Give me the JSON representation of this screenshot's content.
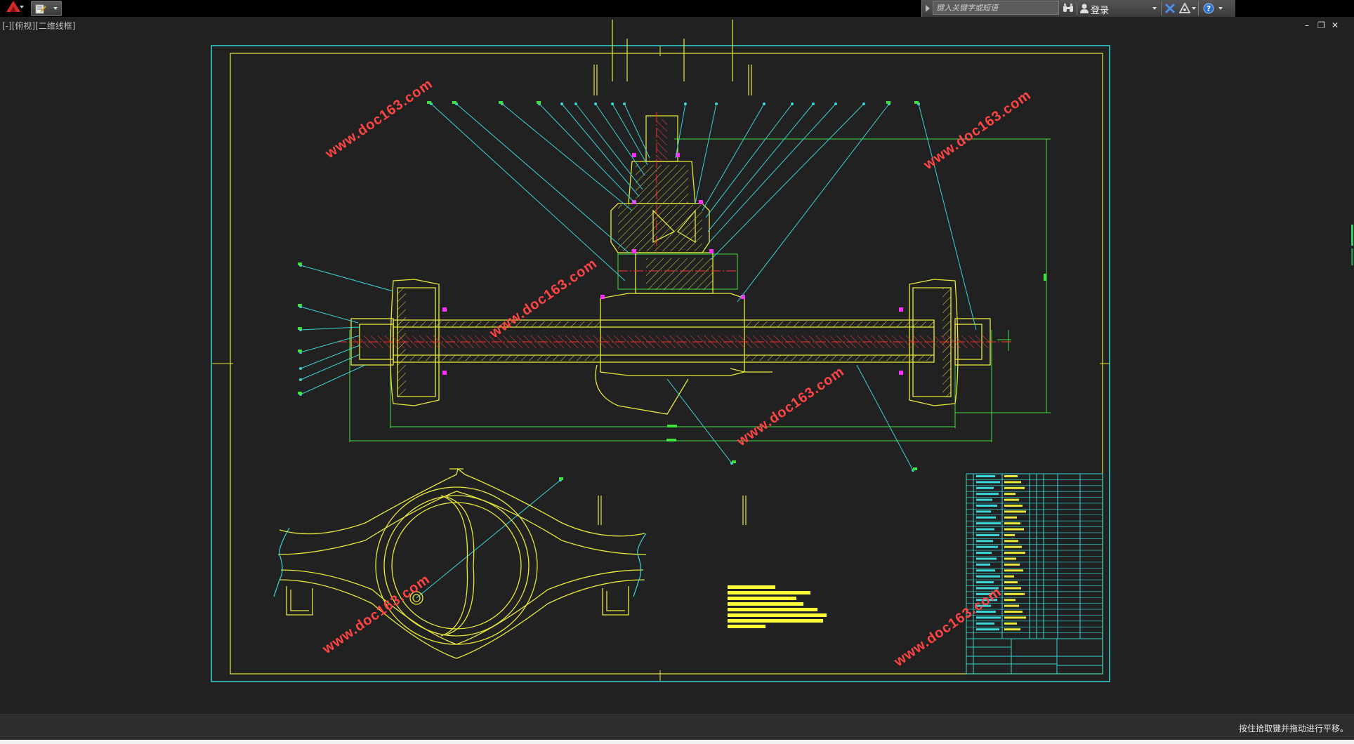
{
  "toolbar": {
    "app_menu_icon": "autocad-logo-icon",
    "quick_access_icon": "edit-document-icon"
  },
  "info_center": {
    "search_placeholder": "键入关键字或短语",
    "login_label": "登录"
  },
  "viewport": {
    "label": "[-][俯视][二维线框]"
  },
  "watermark": {
    "text": "www.doc163.com",
    "color": "#ff3b3b"
  },
  "colors": {
    "background": "#212121",
    "border_cyan": "#33d6d6",
    "geometry_yellow": "#e8e83a",
    "leader_cyan": "#3bd4d4",
    "dim_green": "#40e040",
    "center_red": "#ff3030",
    "accent_magenta": "#ff30ff"
  },
  "status": {
    "message": "按住拾取键并拖动进行平移。"
  }
}
